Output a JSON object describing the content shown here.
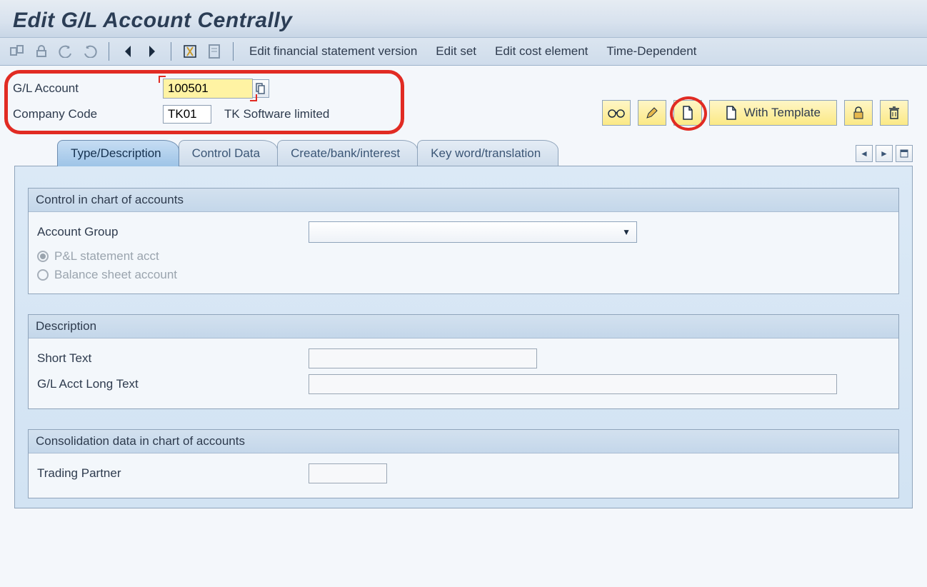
{
  "title": "Edit G/L Account Centrally",
  "toolbar_links": {
    "efs": "Edit financial statement version",
    "editset": "Edit set",
    "ece": "Edit cost element",
    "timedep": "Time-Dependent"
  },
  "header": {
    "gl_label": "G/L Account",
    "gl_value": "100501",
    "cc_label": "Company Code",
    "cc_value": "TK01",
    "cc_desc": "TK Software limited"
  },
  "actions": {
    "with_template": "With Template"
  },
  "tabs": {
    "t1": "Type/Description",
    "t2": "Control Data",
    "t3": "Create/bank/interest",
    "t4": "Key word/translation"
  },
  "group1": {
    "title": "Control in chart of accounts",
    "account_group": "Account Group",
    "pl": "P&L statement acct",
    "bs": "Balance sheet account"
  },
  "group2": {
    "title": "Description",
    "short": "Short Text",
    "long": "G/L Acct Long Text"
  },
  "group3": {
    "title": "Consolidation data in chart of accounts",
    "tp": "Trading Partner"
  }
}
